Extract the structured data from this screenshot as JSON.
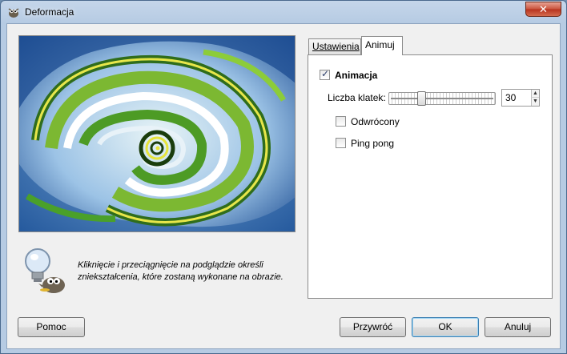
{
  "window": {
    "title": "Deformacja",
    "close_glyph": "✕"
  },
  "preview": {
    "hint_line1": "Kliknięcie i przeciągnięcie na podglądzie określi",
    "hint_line2": "zniekształcenia, które zostaną wykonane na obrazie."
  },
  "tabs": [
    {
      "label": "Ustawienia",
      "active": false
    },
    {
      "label": "Animuj",
      "active": true
    }
  ],
  "animate": {
    "animation_label": "Animacja",
    "animation_checked": true,
    "frames_label": "Liczba klatek:",
    "frames_value": "30",
    "slider_fraction": 0.29,
    "reversed_label": "Odwrócony",
    "reversed_checked": false,
    "pingpong_label": "Ping pong",
    "pingpong_checked": false
  },
  "buttons": {
    "help": "Pomoc",
    "reset": "Przywróć",
    "ok": "OK",
    "cancel": "Anuluj"
  },
  "icons": {
    "app": "gimp-wilber-icon",
    "hint": "lightbulb-wilber-icon",
    "spin_up": "▲",
    "spin_down": "▼",
    "check": "✓"
  },
  "colors": {
    "titlebar": "#b6cbe3",
    "close_button": "#c9533c",
    "dialog_bg": "#f0f0f0",
    "ok_border": "#3c7fb1"
  }
}
